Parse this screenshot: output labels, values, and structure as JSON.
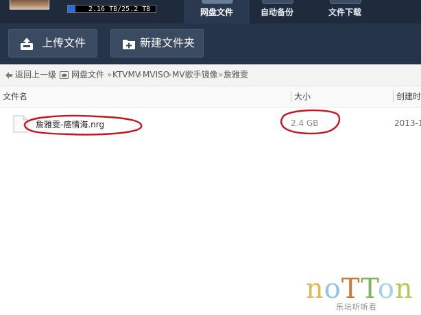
{
  "header": {
    "quota_text": "2.16 TB/25.2 TB",
    "quota_used_fraction": 0.086,
    "tabs": [
      {
        "label": "网盘文件",
        "icon": "cloud-folder-icon",
        "active": true
      },
      {
        "label": "自动备份",
        "icon": "backup-icon",
        "active": false
      },
      {
        "label": "文件下载",
        "icon": "download-icon",
        "active": false
      }
    ]
  },
  "toolbar": {
    "upload_label": "上传文件",
    "upload_icon": "upload-icon",
    "new_folder_label": "新建文件夹",
    "new_folder_icon": "new-folder-icon"
  },
  "breadcrumb": {
    "back_label": "返回上一级",
    "separator": "|",
    "path": [
      "网盘文件",
      "KTVMV",
      "MVISO",
      "MV歌手镜像",
      "詹雅雯"
    ],
    "path_sep": "»"
  },
  "columns": {
    "name": "文件名",
    "size": "大小",
    "created": "创建时"
  },
  "files": [
    {
      "name": "詹雅雯-癌情海.nrg",
      "size": "2.4 GB",
      "created": "2013-1",
      "icon": "file-icon"
    }
  ],
  "watermark": {
    "text": "noTTon",
    "subtext": "乐坛听听看",
    "colors": [
      "#e0b95a",
      "#8fc4e6",
      "#c97a3a",
      "#7fb55a",
      "#a6d1e8",
      "#b8c95a"
    ]
  },
  "colors": {
    "header_bg": "#1f2b3c",
    "toolbar_bg": "#263449",
    "annotation": "#c8141e"
  }
}
